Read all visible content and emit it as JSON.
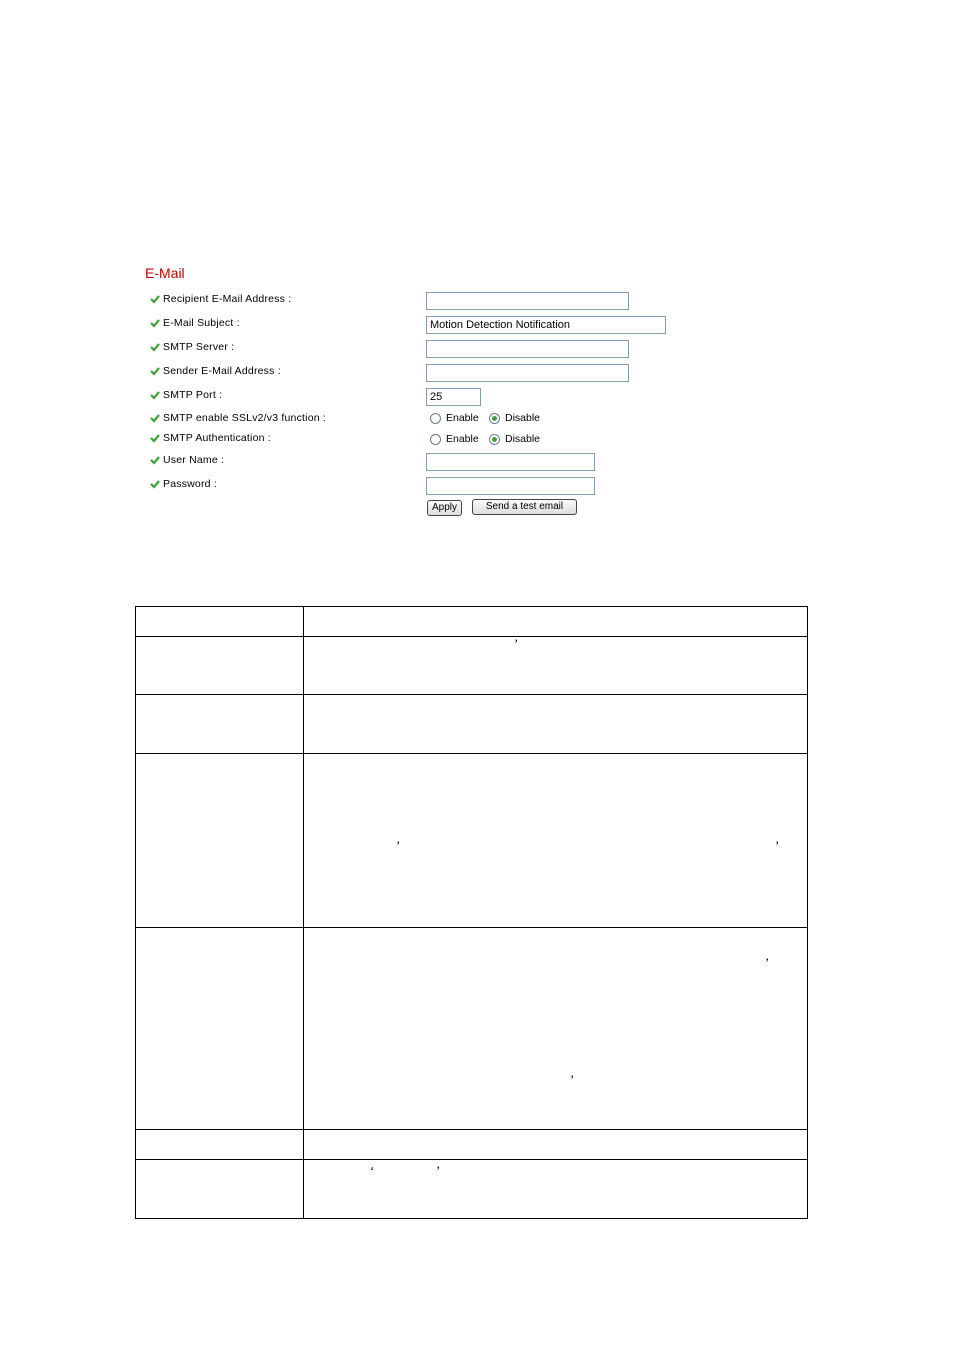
{
  "form": {
    "title": "E-Mail",
    "fields": [
      {
        "label": "Recipient E-Mail Address :",
        "value": ""
      },
      {
        "label": "E-Mail Subject :",
        "value": "Motion Detection Notification"
      },
      {
        "label": "SMTP Server :",
        "value": ""
      },
      {
        "label": "Sender E-Mail Address :",
        "value": ""
      },
      {
        "label": "SMTP Port :",
        "value": "25"
      },
      {
        "label": "User Name :",
        "value": ""
      },
      {
        "label": "Password :",
        "value": ""
      }
    ],
    "ssl": {
      "label": "SMTP enable SSLv2/v3 function :",
      "options": [
        "Enable",
        "Disable"
      ],
      "selected": "Disable"
    },
    "auth": {
      "label": "SMTP Authentication :",
      "options": [
        "Enable",
        "Disable"
      ],
      "selected": "Disable"
    },
    "apply_label": "Apply",
    "test_label": "Send a test email"
  },
  "table": {
    "marks": {
      "comma": "’",
      "open_quote": "‘"
    }
  },
  "colors": {
    "title": "#c00000",
    "check": "#3aa13a"
  }
}
